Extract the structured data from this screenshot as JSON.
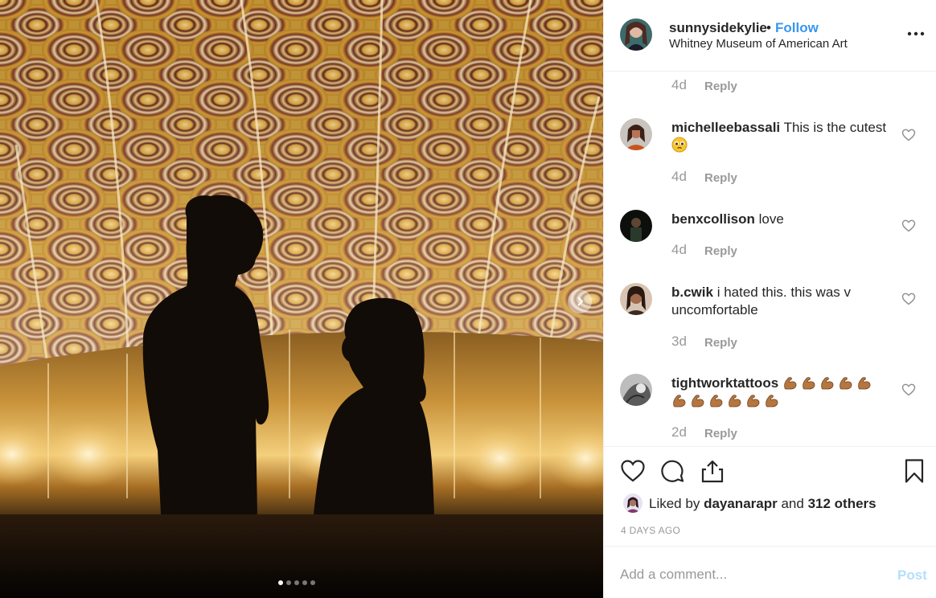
{
  "post": {
    "username": "sunnysidekylie",
    "separator": "•",
    "follow_label": "Follow",
    "location": "Whitney Museum of American Art",
    "more_icon": "more-options-icon",
    "carousel": {
      "slide_count": 5,
      "active_index": 0,
      "next_icon": "chevron-right-icon"
    }
  },
  "comments": {
    "top_partial": {
      "time": "4d",
      "reply_label": "Reply"
    },
    "items": [
      {
        "username": "michelleebassali",
        "text": "This is the cutest",
        "emoji": "pleading-face-emoji",
        "time": "4d",
        "reply_label": "Reply"
      },
      {
        "username": "benxcollison",
        "text": "love",
        "time": "4d",
        "reply_label": "Reply"
      },
      {
        "username": "b.cwik",
        "text": "i hated this. this was v uncomfortable",
        "time": "3d",
        "reply_label": "Reply"
      },
      {
        "username": "tightworktattoos",
        "text": "",
        "emoji": "flexed-biceps-emoji",
        "emoji_count": 11,
        "time": "2d",
        "reply_label": "Reply"
      }
    ]
  },
  "actions": {
    "icons": [
      "heart-icon",
      "comment-icon",
      "share-icon",
      "bookmark-icon"
    ],
    "liked_prefix": "Liked by",
    "liked_user": "dayanarapr",
    "liked_and": "and",
    "liked_others": "312 others",
    "date": "4 DAYS AGO"
  },
  "composer": {
    "placeholder": "Add a comment...",
    "post_label": "Post",
    "post_color": "#b2dffc"
  },
  "colors": {
    "link": "#3897f0",
    "muted": "#999999",
    "text": "#262626",
    "ceiling_gold": "#c79a2c",
    "ceiling_maroon": "#5a1d16"
  }
}
